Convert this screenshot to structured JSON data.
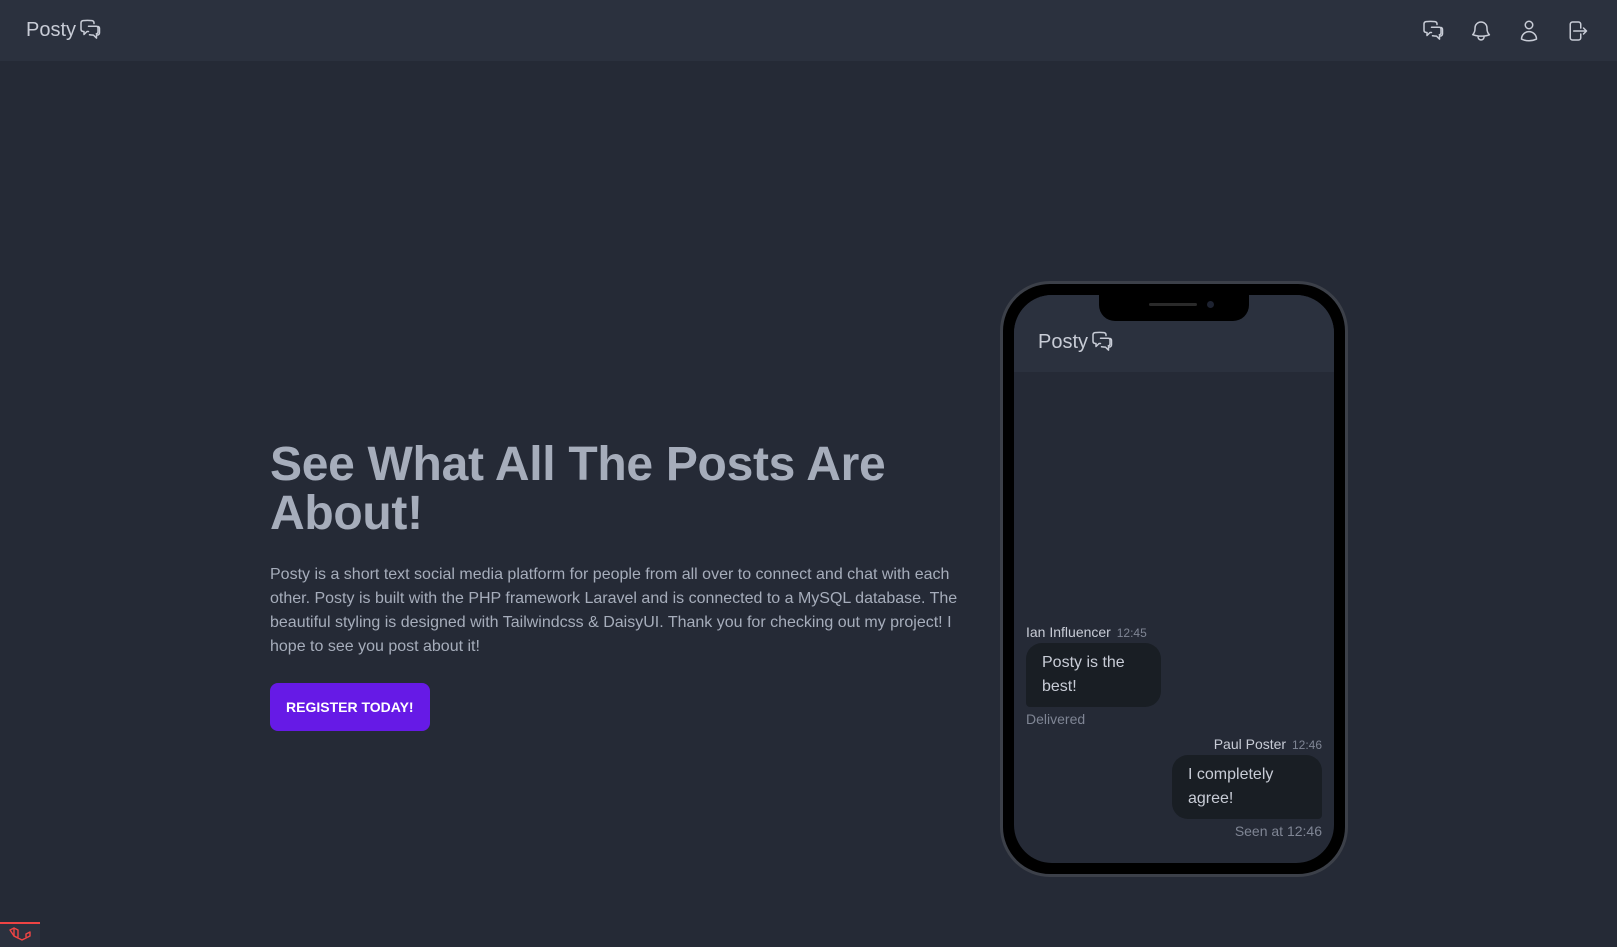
{
  "navbar": {
    "brand": "Posty",
    "icons": [
      "chat-icon",
      "bell-icon",
      "user-icon",
      "logout-icon"
    ]
  },
  "hero": {
    "title": "See What All The Posts Are About!",
    "description": "Posty is a short text social media platform for people from all over to connect and chat with each other. Posty is built with the PHP framework Laravel and is connected to a MySQL database. The beautiful styling is designed with Tailwindcss & DaisyUI. Thank you for checking out my project! I hope to see you post about it!",
    "button_label": "REGISTER TODAY!"
  },
  "phone": {
    "brand": "Posty",
    "messages": [
      {
        "author": "Ian Influencer",
        "time": "12:45",
        "text": "Posty is the best!",
        "footer": "Delivered"
      },
      {
        "author": "Paul Poster",
        "time": "12:46",
        "text": "I completely agree!",
        "footer": "Seen at 12:46"
      }
    ]
  },
  "colors": {
    "background": "#252a36",
    "navbar": "#2b313e",
    "primary": "#661ae6",
    "text": "#a6adbb",
    "bubble": "#191e24"
  }
}
